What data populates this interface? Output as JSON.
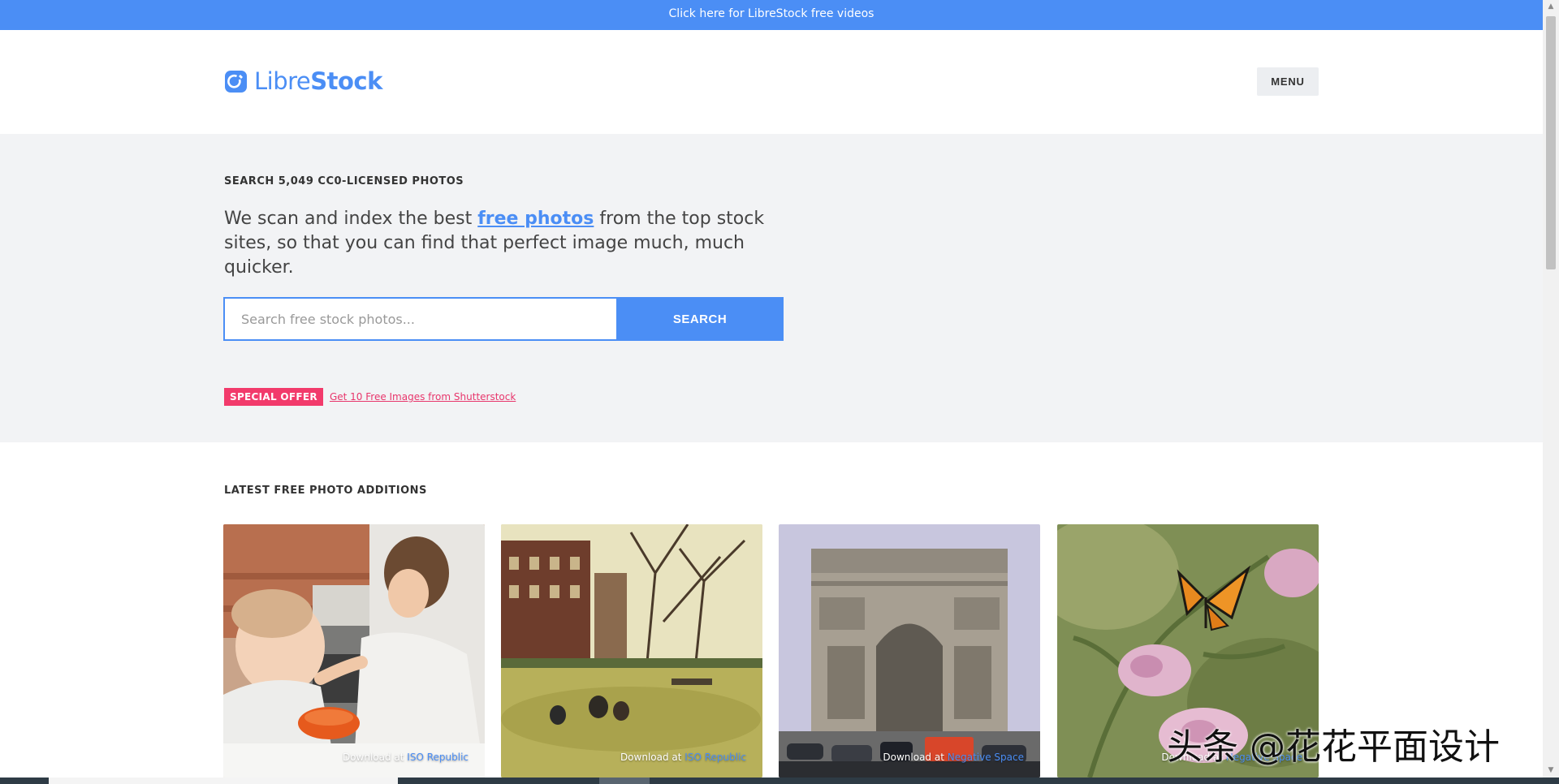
{
  "topbar": {
    "text": "Click here for LibreStock free videos"
  },
  "header": {
    "logo_light": "Libre",
    "logo_bold": "Stock",
    "menu_label": "MENU"
  },
  "hero": {
    "kicker": "SEARCH 5,049 CC0-LICENSED PHOTOS",
    "lead_before": "We scan and index the best ",
    "lead_link": "free photos",
    "lead_after": " from the top stock sites, so that you can find that perfect image much, much quicker.",
    "search": {
      "placeholder": "Search free stock photos...",
      "value": "",
      "button_label": "SEARCH"
    },
    "offer": {
      "badge": "SPECIAL OFFER",
      "link": "Get 10 Free Images from Shutterstock"
    }
  },
  "latest": {
    "title": "LATEST FREE PHOTO ADDITIONS",
    "photos": [
      {
        "subject": "mother feeding baby",
        "credit_prefix": "Download at",
        "source": "ISO Republic"
      },
      {
        "subject": "park with people on grass",
        "credit_prefix": "Download at",
        "source": "ISO Republic"
      },
      {
        "subject": "Arc de Triomphe",
        "credit_prefix": "Download at",
        "source": "Negative Space"
      },
      {
        "subject": "monarch butterfly on milkweed",
        "credit_prefix": "Download at",
        "source": "Negative Space"
      }
    ]
  },
  "watermark": "头条 @花花平面设计",
  "colors": {
    "accent": "#4b8ef5",
    "offer": "#f23a6b",
    "hero_bg": "#f2f3f5"
  }
}
